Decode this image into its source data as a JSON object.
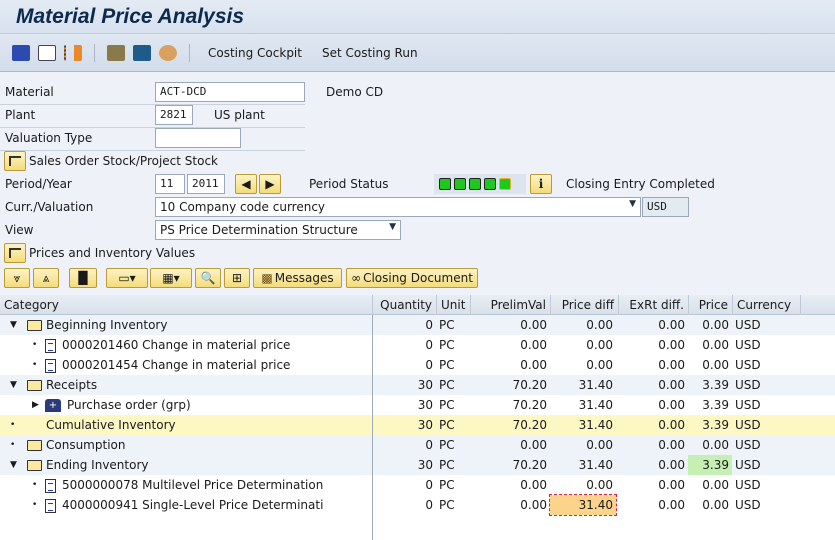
{
  "title": "Material Price Analysis",
  "toolbar": {
    "costing_cockpit": "Costing Cockpit",
    "set_costing_run": "Set Costing Run"
  },
  "form": {
    "material_label": "Material",
    "material_value": "ACT-DCD",
    "material_desc": "Demo CD",
    "plant_label": "Plant",
    "plant_value": "2821",
    "plant_desc": "US plant",
    "valuation_type_label": "Valuation Type",
    "valuation_type_value": "",
    "sales_order_stock_label": "Sales Order Stock/Project Stock",
    "period_label": "Period/Year",
    "period_value": "11",
    "year_value": "2011",
    "period_status_label": "Period Status",
    "period_status_text": "Closing Entry Completed",
    "currency_label": "Curr./Valuation",
    "currency_value": "10 Company code currency",
    "currency_code": "USD",
    "view_label": "View",
    "view_value": "PS Price Determination Structure",
    "prices_inventory_label": "Prices and Inventory Values"
  },
  "grid_toolbar": {
    "messages": "Messages",
    "closing_document": "Closing Document"
  },
  "grid": {
    "columns": [
      "Category",
      "Quantity",
      "Unit",
      "PrelimVal",
      "Price diff",
      "ExRt diff.",
      "Price",
      "Currency"
    ],
    "rows": [
      {
        "label": "Beginning Inventory",
        "qty": "0",
        "unit": "PC",
        "prelim": "0.00",
        "pdiff": "0.00",
        "exrt": "0.00",
        "price": "0.00",
        "cur": "USD"
      },
      {
        "label": "0000201460 Change in material price",
        "qty": "0",
        "unit": "PC",
        "prelim": "0.00",
        "pdiff": "0.00",
        "exrt": "0.00",
        "price": "0.00",
        "cur": "USD"
      },
      {
        "label": "0000201454 Change in material price",
        "qty": "0",
        "unit": "PC",
        "prelim": "0.00",
        "pdiff": "0.00",
        "exrt": "0.00",
        "price": "0.00",
        "cur": "USD"
      },
      {
        "label": "Receipts",
        "qty": "30",
        "unit": "PC",
        "prelim": "70.20",
        "pdiff": "31.40",
        "exrt": "0.00",
        "price": "3.39",
        "cur": "USD"
      },
      {
        "label": "Purchase order (grp)",
        "qty": "30",
        "unit": "PC",
        "prelim": "70.20",
        "pdiff": "31.40",
        "exrt": "0.00",
        "price": "3.39",
        "cur": "USD"
      },
      {
        "label": "Cumulative Inventory",
        "qty": "30",
        "unit": "PC",
        "prelim": "70.20",
        "pdiff": "31.40",
        "exrt": "0.00",
        "price": "3.39",
        "cur": "USD"
      },
      {
        "label": "Consumption",
        "qty": "0",
        "unit": "PC",
        "prelim": "0.00",
        "pdiff": "0.00",
        "exrt": "0.00",
        "price": "0.00",
        "cur": "USD"
      },
      {
        "label": "Ending Inventory",
        "qty": "30",
        "unit": "PC",
        "prelim": "70.20",
        "pdiff": "31.40",
        "exrt": "0.00",
        "price": "3.39",
        "cur": "USD"
      },
      {
        "label": "5000000078 Multilevel Price Determination",
        "qty": "0",
        "unit": "PC",
        "prelim": "0.00",
        "pdiff": "0.00",
        "exrt": "0.00",
        "price": "0.00",
        "cur": "USD"
      },
      {
        "label": "4000000941 Single-Level Price Determinati",
        "qty": "0",
        "unit": "PC",
        "prelim": "0.00",
        "pdiff": "31.40",
        "exrt": "0.00",
        "price": "0.00",
        "cur": "USD"
      }
    ]
  }
}
